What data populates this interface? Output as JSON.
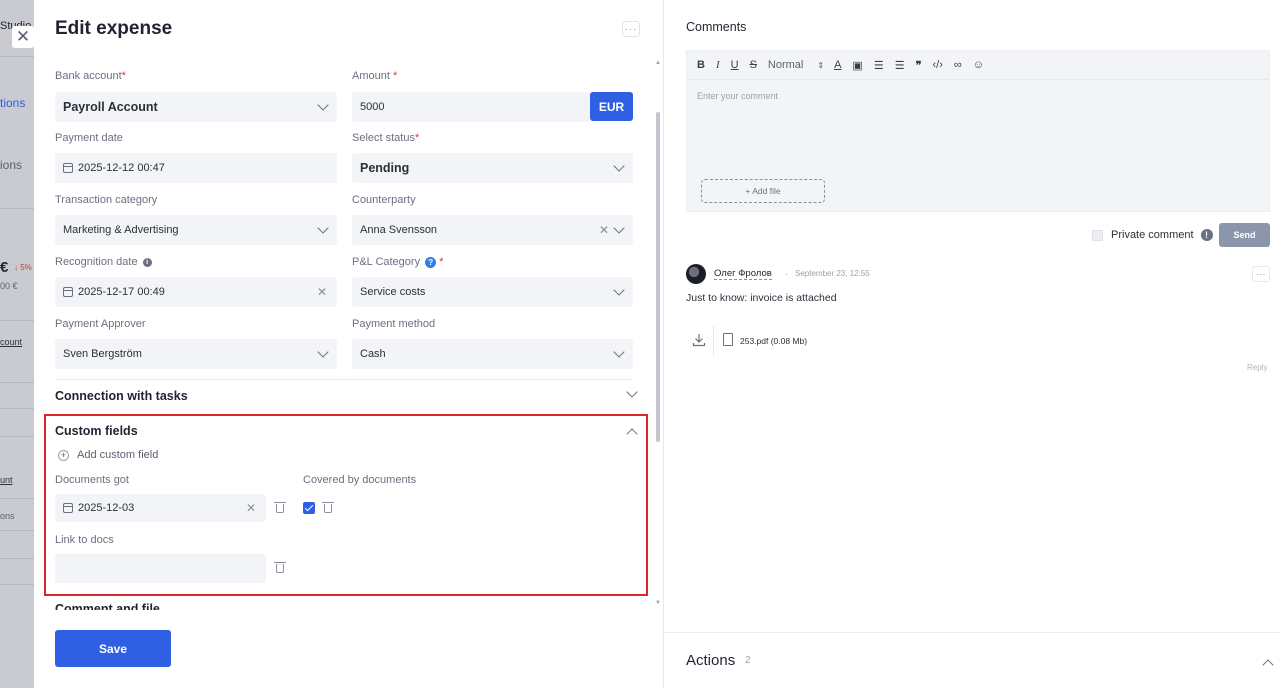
{
  "background": {
    "nav_items": [
      "Studio",
      "tions",
      "ions"
    ],
    "amount": "€",
    "delta": "↓ 5%",
    "amount_sub": "00 €",
    "links": [
      "count",
      "unt",
      "ons"
    ]
  },
  "panel": {
    "title": "Edit expense",
    "more_label": "···",
    "save_label": "Save"
  },
  "form": {
    "bank_account": {
      "label": "Bank account",
      "value": "Payroll Account"
    },
    "amount": {
      "label": "Amount",
      "value": "5000",
      "currency": "EUR"
    },
    "payment_date": {
      "label": "Payment date",
      "value": "2025-12-12 00:47"
    },
    "status": {
      "label": "Select status",
      "value": "Pending"
    },
    "category": {
      "label": "Transaction category",
      "value": "Marketing & Advertising"
    },
    "counterparty": {
      "label": "Counterparty",
      "value": "Anna Svensson"
    },
    "recognition_date": {
      "label": "Recognition date",
      "value": "2025-12-17 00:49"
    },
    "pl_category": {
      "label": "P&L Category",
      "value": "Service costs"
    },
    "approver": {
      "label": "Payment Approver",
      "value": "Sven Bergström"
    },
    "payment_method": {
      "label": "Payment method",
      "value": "Cash"
    }
  },
  "sections": {
    "connection_tasks": "Connection with tasks",
    "custom_fields": "Custom fields",
    "comment_file": "Comment and file"
  },
  "custom_fields": {
    "add_label": "Add custom field",
    "documents_got": {
      "label": "Documents got",
      "value": "2025-12-03"
    },
    "covered": {
      "label": "Covered by documents",
      "checked": true
    },
    "link_docs": {
      "label": "Link to docs",
      "value": ""
    }
  },
  "comments": {
    "title": "Comments",
    "toolbar": [
      "B",
      "I",
      "U",
      "S",
      "Normal"
    ],
    "placeholder": "Enter your comment",
    "add_file": "+ Add file",
    "private_label": "Private comment",
    "send_label": "Send",
    "items": [
      {
        "author": "Олег Фролов",
        "time": "September 23, 12:55",
        "text": "Just to know: invoice is attached",
        "attachment": "253.pdf (0.08 Mb)",
        "reply_label": "Reply"
      }
    ]
  },
  "actions": {
    "label": "Actions",
    "count": "2"
  },
  "colors": {
    "accent": "#2f5fe3",
    "highlight_border": "#d8262b",
    "send_disabled": "#8b96ab"
  }
}
